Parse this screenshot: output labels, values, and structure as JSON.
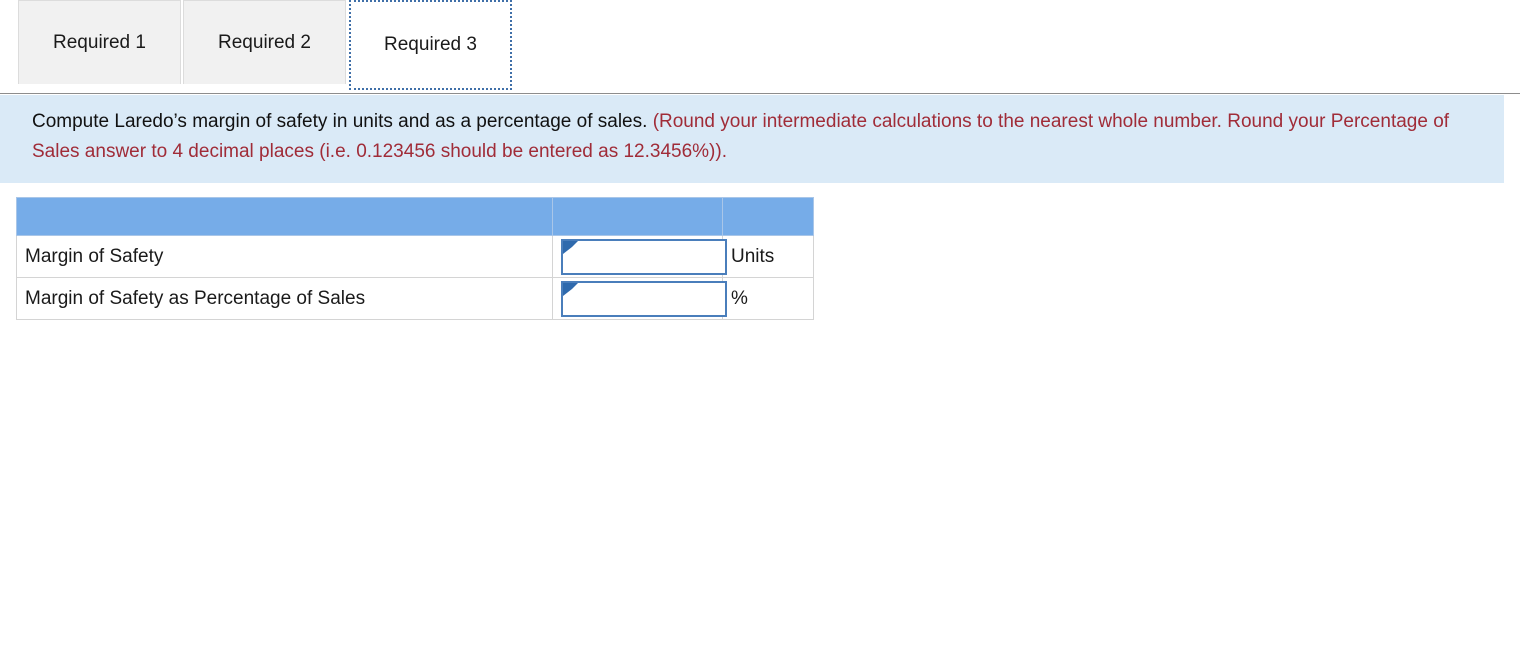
{
  "tabs": [
    {
      "label": "Required 1",
      "active": false
    },
    {
      "label": "Required 2",
      "active": false
    },
    {
      "label": "Required 3",
      "active": true
    }
  ],
  "banner": {
    "prompt": "Compute Laredo’s margin of safety in units and as a percentage of sales.",
    "hint": "(Round your intermediate calculations to the nearest whole number. Round your Percentage of Sales answer to 4 decimal places (i.e. 0.123456 should be entered as 12.3456%))."
  },
  "table": {
    "headers": [
      "",
      "",
      ""
    ],
    "rows": [
      {
        "label": "Margin of Safety",
        "value": "",
        "placeholder": "",
        "unit": "Units"
      },
      {
        "label": "Margin of Safety as Percentage of Sales",
        "value": "",
        "placeholder": "",
        "unit": "%"
      }
    ]
  },
  "colors": {
    "header_blue": "#76ace8",
    "banner_bg": "#daeaf7",
    "hint_red": "#a02c38",
    "input_border": "#4a7ebb",
    "tab_inactive_bg": "#f1f1f1"
  }
}
